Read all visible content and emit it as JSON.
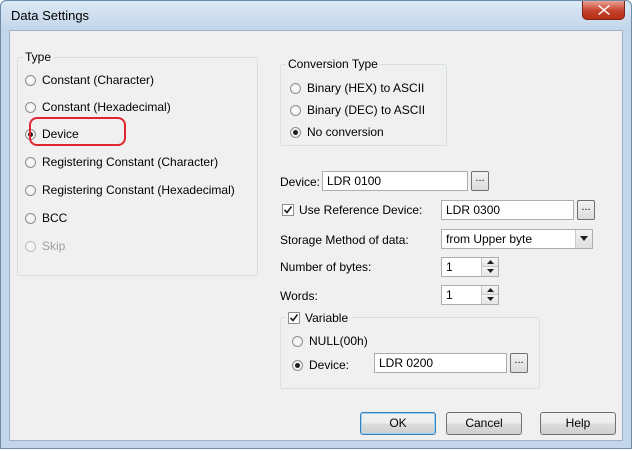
{
  "window": {
    "title": "Data Settings",
    "close_glyph": "close-x-icon"
  },
  "type_group": {
    "legend": "Type",
    "options": [
      {
        "label": "Constant (Character)",
        "selected": false,
        "enabled": true
      },
      {
        "label": "Constant (Hexadecimal)",
        "selected": false,
        "enabled": true
      },
      {
        "label": "Device",
        "selected": true,
        "enabled": true
      },
      {
        "label": "Registering Constant (Character)",
        "selected": false,
        "enabled": true
      },
      {
        "label": "Registering Constant (Hexadecimal)",
        "selected": false,
        "enabled": true
      },
      {
        "label": "BCC",
        "selected": false,
        "enabled": true
      },
      {
        "label": "Skip",
        "selected": false,
        "enabled": false
      }
    ]
  },
  "conversion_group": {
    "legend": "Conversion Type",
    "options": [
      {
        "label": "Binary (HEX) to ASCII",
        "selected": false
      },
      {
        "label": "Binary (DEC) to ASCII",
        "selected": false
      },
      {
        "label": "No conversion",
        "selected": true
      }
    ]
  },
  "device": {
    "label": "Device:",
    "value": "LDR 0100",
    "browse_label": "..."
  },
  "reference_device": {
    "label": "Use Reference Device:",
    "checked": true,
    "value": "LDR 0300",
    "browse_label": "..."
  },
  "storage_method": {
    "label": "Storage Method of data:",
    "value": "from Upper byte"
  },
  "number_of_bytes": {
    "label": "Number of bytes:",
    "value": "1"
  },
  "words": {
    "label": "Words:",
    "value": "1"
  },
  "variable_group": {
    "legend": "Variable",
    "checked": true,
    "options": [
      {
        "label": "NULL(00h)",
        "selected": false
      },
      {
        "label": "Device:",
        "selected": true
      }
    ],
    "device_value": "LDR 0200",
    "browse_label": "..."
  },
  "buttons": {
    "ok": "OK",
    "cancel": "Cancel",
    "help": "Help"
  },
  "colors": {
    "highlight_ring": "#e0262e",
    "close_button": "#c4412b",
    "frame": "#c3d6ea"
  }
}
